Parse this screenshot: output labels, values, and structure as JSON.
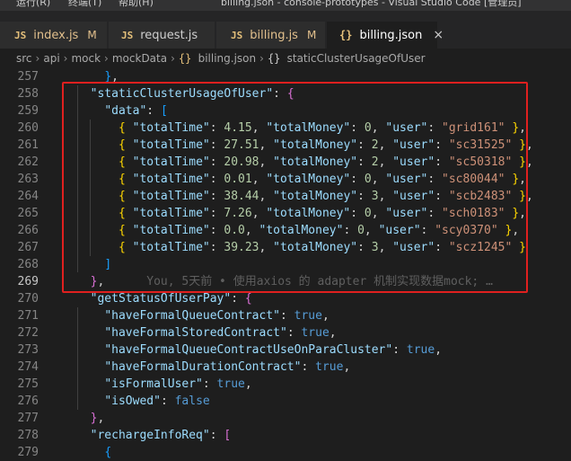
{
  "titlebar": {
    "menu": [
      "运行(R)",
      "终端(T)",
      "帮助(H)"
    ],
    "title": "billing.json - console-prototypes - Visual Studio Code [管理员]"
  },
  "tabs": [
    {
      "icon": "JS",
      "label": "index.js",
      "badge": "M"
    },
    {
      "icon": "JS",
      "label": "request.js",
      "badge": ""
    },
    {
      "icon": "JS",
      "label": "billing.js",
      "badge": "M"
    },
    {
      "icon": "{}",
      "label": "billing.json",
      "badge": "×"
    }
  ],
  "breadcrumb": [
    "src",
    "api",
    "mock",
    "mockData",
    "billing.json",
    "staticClusterUsageOfUser"
  ],
  "editor": {
    "lines": [
      {
        "num": "257",
        "tokens": [
          [
            "p",
            "    "
          ],
          [
            "br3",
            "}"
          ],
          [
            "p",
            ","
          ]
        ]
      },
      {
        "num": "258",
        "tokens": [
          [
            "p",
            "  "
          ],
          [
            "k",
            "\"staticClusterUsageOfUser\""
          ],
          [
            "p",
            ": "
          ],
          [
            "br2",
            "{"
          ]
        ]
      },
      {
        "num": "259",
        "tokens": [
          [
            "p",
            "    "
          ],
          [
            "k",
            "\"data\""
          ],
          [
            "p",
            ": "
          ],
          [
            "br3",
            "["
          ]
        ]
      },
      {
        "num": "260",
        "tokens": [
          [
            "p",
            "      "
          ],
          [
            "br1",
            "{"
          ],
          [
            "p",
            " "
          ],
          [
            "k",
            "\"totalTime\""
          ],
          [
            "p",
            ": "
          ],
          [
            "n",
            "4.15"
          ],
          [
            "p",
            ", "
          ],
          [
            "k",
            "\"totalMoney\""
          ],
          [
            "p",
            ": "
          ],
          [
            "n",
            "0"
          ],
          [
            "p",
            ", "
          ],
          [
            "k",
            "\"user\""
          ],
          [
            "p",
            ": "
          ],
          [
            "s",
            "\"grid161\""
          ],
          [
            "p",
            " "
          ],
          [
            "br1",
            "}"
          ],
          [
            "p",
            ","
          ]
        ]
      },
      {
        "num": "261",
        "tokens": [
          [
            "p",
            "      "
          ],
          [
            "br1",
            "{"
          ],
          [
            "p",
            " "
          ],
          [
            "k",
            "\"totalTime\""
          ],
          [
            "p",
            ": "
          ],
          [
            "n",
            "27.51"
          ],
          [
            "p",
            ", "
          ],
          [
            "k",
            "\"totalMoney\""
          ],
          [
            "p",
            ": "
          ],
          [
            "n",
            "2"
          ],
          [
            "p",
            ", "
          ],
          [
            "k",
            "\"user\""
          ],
          [
            "p",
            ": "
          ],
          [
            "s",
            "\"sc31525\""
          ],
          [
            "p",
            " "
          ],
          [
            "br1",
            "}"
          ],
          [
            "p",
            ","
          ]
        ]
      },
      {
        "num": "262",
        "tokens": [
          [
            "p",
            "      "
          ],
          [
            "br1",
            "{"
          ],
          [
            "p",
            " "
          ],
          [
            "k",
            "\"totalTime\""
          ],
          [
            "p",
            ": "
          ],
          [
            "n",
            "20.98"
          ],
          [
            "p",
            ", "
          ],
          [
            "k",
            "\"totalMoney\""
          ],
          [
            "p",
            ": "
          ],
          [
            "n",
            "2"
          ],
          [
            "p",
            ", "
          ],
          [
            "k",
            "\"user\""
          ],
          [
            "p",
            ": "
          ],
          [
            "s",
            "\"sc50318\""
          ],
          [
            "p",
            " "
          ],
          [
            "br1",
            "}"
          ],
          [
            "p",
            ","
          ]
        ]
      },
      {
        "num": "263",
        "tokens": [
          [
            "p",
            "      "
          ],
          [
            "br1",
            "{"
          ],
          [
            "p",
            " "
          ],
          [
            "k",
            "\"totalTime\""
          ],
          [
            "p",
            ": "
          ],
          [
            "n",
            "0.01"
          ],
          [
            "p",
            ", "
          ],
          [
            "k",
            "\"totalMoney\""
          ],
          [
            "p",
            ": "
          ],
          [
            "n",
            "0"
          ],
          [
            "p",
            ", "
          ],
          [
            "k",
            "\"user\""
          ],
          [
            "p",
            ": "
          ],
          [
            "s",
            "\"sc80044\""
          ],
          [
            "p",
            " "
          ],
          [
            "br1",
            "}"
          ],
          [
            "p",
            ","
          ]
        ]
      },
      {
        "num": "264",
        "tokens": [
          [
            "p",
            "      "
          ],
          [
            "br1",
            "{"
          ],
          [
            "p",
            " "
          ],
          [
            "k",
            "\"totalTime\""
          ],
          [
            "p",
            ": "
          ],
          [
            "n",
            "38.44"
          ],
          [
            "p",
            ", "
          ],
          [
            "k",
            "\"totalMoney\""
          ],
          [
            "p",
            ": "
          ],
          [
            "n",
            "3"
          ],
          [
            "p",
            ", "
          ],
          [
            "k",
            "\"user\""
          ],
          [
            "p",
            ": "
          ],
          [
            "s",
            "\"scb2483\""
          ],
          [
            "p",
            " "
          ],
          [
            "br1",
            "}"
          ],
          [
            "p",
            ","
          ]
        ]
      },
      {
        "num": "265",
        "tokens": [
          [
            "p",
            "      "
          ],
          [
            "br1",
            "{"
          ],
          [
            "p",
            " "
          ],
          [
            "k",
            "\"totalTime\""
          ],
          [
            "p",
            ": "
          ],
          [
            "n",
            "7.26"
          ],
          [
            "p",
            ", "
          ],
          [
            "k",
            "\"totalMoney\""
          ],
          [
            "p",
            ": "
          ],
          [
            "n",
            "0"
          ],
          [
            "p",
            ", "
          ],
          [
            "k",
            "\"user\""
          ],
          [
            "p",
            ": "
          ],
          [
            "s",
            "\"sch0183\""
          ],
          [
            "p",
            " "
          ],
          [
            "br1",
            "}"
          ],
          [
            "p",
            ","
          ]
        ]
      },
      {
        "num": "266",
        "tokens": [
          [
            "p",
            "      "
          ],
          [
            "br1",
            "{"
          ],
          [
            "p",
            " "
          ],
          [
            "k",
            "\"totalTime\""
          ],
          [
            "p",
            ": "
          ],
          [
            "n",
            "0.0"
          ],
          [
            "p",
            ", "
          ],
          [
            "k",
            "\"totalMoney\""
          ],
          [
            "p",
            ": "
          ],
          [
            "n",
            "0"
          ],
          [
            "p",
            ", "
          ],
          [
            "k",
            "\"user\""
          ],
          [
            "p",
            ": "
          ],
          [
            "s",
            "\"scy0370\""
          ],
          [
            "p",
            " "
          ],
          [
            "br1",
            "}"
          ],
          [
            "p",
            ","
          ]
        ]
      },
      {
        "num": "267",
        "tokens": [
          [
            "p",
            "      "
          ],
          [
            "br1",
            "{"
          ],
          [
            "p",
            " "
          ],
          [
            "k",
            "\"totalTime\""
          ],
          [
            "p",
            ": "
          ],
          [
            "n",
            "39.23"
          ],
          [
            "p",
            ", "
          ],
          [
            "k",
            "\"totalMoney\""
          ],
          [
            "p",
            ": "
          ],
          [
            "n",
            "3"
          ],
          [
            "p",
            ", "
          ],
          [
            "k",
            "\"user\""
          ],
          [
            "p",
            ": "
          ],
          [
            "s",
            "\"scz1245\""
          ],
          [
            "p",
            " "
          ],
          [
            "br1",
            "}"
          ]
        ]
      },
      {
        "num": "268",
        "tokens": [
          [
            "p",
            "    "
          ],
          [
            "br3",
            "]"
          ]
        ]
      },
      {
        "num": "269",
        "tokens": [
          [
            "p",
            "  "
          ],
          [
            "br2",
            "}"
          ],
          [
            "p",
            ","
          ],
          [
            "blame",
            "      You, 5天前 • 使用axios 的 adapter 机制实现数据mock; …"
          ]
        ]
      },
      {
        "num": "270",
        "tokens": [
          [
            "p",
            "  "
          ],
          [
            "k",
            "\"getStatusOfUserPay\""
          ],
          [
            "p",
            ": "
          ],
          [
            "br2",
            "{"
          ]
        ]
      },
      {
        "num": "271",
        "tokens": [
          [
            "p",
            "    "
          ],
          [
            "k",
            "\"haveFormalQueueContract\""
          ],
          [
            "p",
            ": "
          ],
          [
            "b",
            "true"
          ],
          [
            "p",
            ","
          ]
        ]
      },
      {
        "num": "272",
        "tokens": [
          [
            "p",
            "    "
          ],
          [
            "k",
            "\"haveFormalStoredContract\""
          ],
          [
            "p",
            ": "
          ],
          [
            "b",
            "true"
          ],
          [
            "p",
            ","
          ]
        ]
      },
      {
        "num": "273",
        "tokens": [
          [
            "p",
            "    "
          ],
          [
            "k",
            "\"haveFormalQueueContractUseOnParaCluster\""
          ],
          [
            "p",
            ": "
          ],
          [
            "b",
            "true"
          ],
          [
            "p",
            ","
          ]
        ]
      },
      {
        "num": "274",
        "tokens": [
          [
            "p",
            "    "
          ],
          [
            "k",
            "\"haveFormalDurationContract\""
          ],
          [
            "p",
            ": "
          ],
          [
            "b",
            "true"
          ],
          [
            "p",
            ","
          ]
        ]
      },
      {
        "num": "275",
        "tokens": [
          [
            "p",
            "    "
          ],
          [
            "k",
            "\"isFormalUser\""
          ],
          [
            "p",
            ": "
          ],
          [
            "b",
            "true"
          ],
          [
            "p",
            ","
          ]
        ]
      },
      {
        "num": "276",
        "tokens": [
          [
            "p",
            "    "
          ],
          [
            "k",
            "\"isOwed\""
          ],
          [
            "p",
            ": "
          ],
          [
            "b",
            "false"
          ]
        ]
      },
      {
        "num": "277",
        "tokens": [
          [
            "p",
            "  "
          ],
          [
            "br2",
            "}"
          ],
          [
            "p",
            ","
          ]
        ]
      },
      {
        "num": "278",
        "tokens": [
          [
            "p",
            "  "
          ],
          [
            "k",
            "\"rechargeInfoReq\""
          ],
          [
            "p",
            ": "
          ],
          [
            "br2",
            "["
          ]
        ]
      },
      {
        "num": "279",
        "tokens": [
          [
            "p",
            "    "
          ],
          [
            "br3",
            "{"
          ]
        ]
      }
    ],
    "current_line": "269"
  }
}
